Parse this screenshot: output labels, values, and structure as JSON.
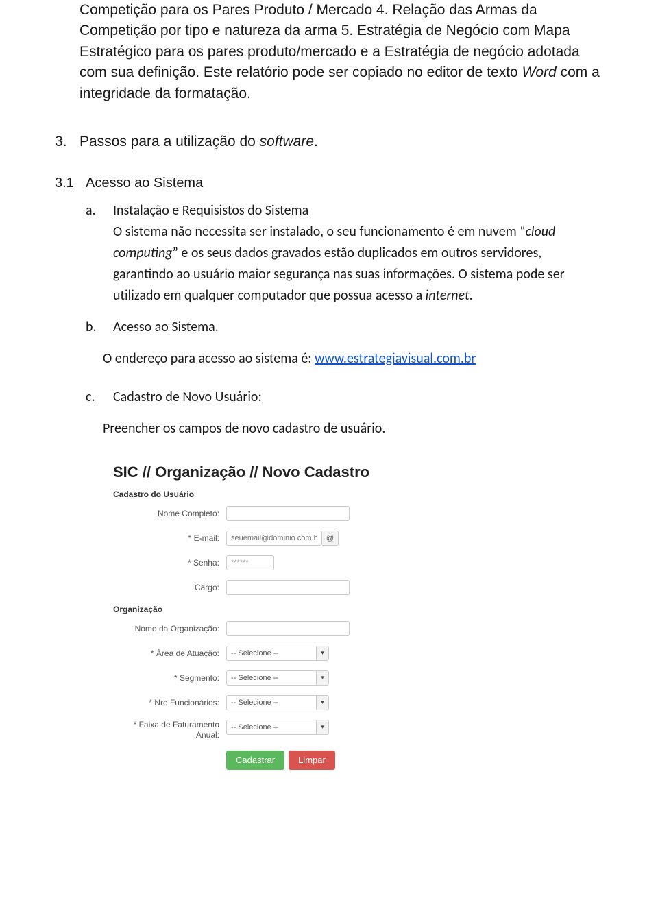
{
  "intro_l1": "Competição para os Pares Produto / Mercado 4. Relação das Armas da Competição por tipo e natureza da arma 5. Estratégia de Negócio com Mapa Estratégico para os pares produto/mercado e a Estratégia de negócio adotada com sua definição. Este relatório pode ser copiado no editor de texto ",
  "intro_italic_word": "Word",
  "intro_l2": " com a integridade da formatação.",
  "sec3_num": "3.",
  "sec3_pre": "Passos para a utilização do ",
  "sec3_italic": "software",
  "sec3_post": ".",
  "sub31_num": "3.1",
  "sub31_title": "Acesso ao Sistema",
  "item_a_letter": "a.",
  "item_a_line1": "Instalação e Requisistos do Sistema",
  "item_a_line2_pre": "O sistema não necessita ser instalado, o seu funcionamento é em nuvem “",
  "item_a_italic": "cloud computing",
  "item_a_line2_post": "” e os seus dados gravados estão duplicados em outros servidores, garantindo ao usuário maior segurança nas suas informações. O sistema pode ser utilizado em qualquer computador que possua acesso a ",
  "item_a_italic2": "internet",
  "item_a_end": ".",
  "item_b_letter": "b.",
  "item_b_title": "Acesso ao Sistema.",
  "item_b_text": "O endereço para acesso ao sistema é: ",
  "item_b_link": "www.estrategiavisual.com.br",
  "item_c_letter": "c.",
  "item_c_title": "Cadastro de Novo Usuário:",
  "item_c_text": "Preencher os campos de novo cadastro de usuário.",
  "form": {
    "title": "SIC // Organização // Novo Cadastro",
    "section_user": "Cadastro do Usuário",
    "labels": {
      "nome": "Nome Completo:",
      "email": "* E-mail:",
      "senha": "* Senha:",
      "cargo": "Cargo:"
    },
    "email_placeholder": "seuemail@dominio.com.br",
    "senha_value": "******",
    "addon_at": "@",
    "section_org": "Organização",
    "org_labels": {
      "nome_org": "Nome da Organização:",
      "area": "* Área de Atuação:",
      "segmento": "* Segmento:",
      "nro": "* Nro Funcionários:",
      "faixa": "* Faixa de Faturamento Anual:"
    },
    "select_placeholder": "-- Selecione --",
    "caret": "▾",
    "btn_cadastrar": "Cadastrar",
    "btn_limpar": "Limpar"
  }
}
